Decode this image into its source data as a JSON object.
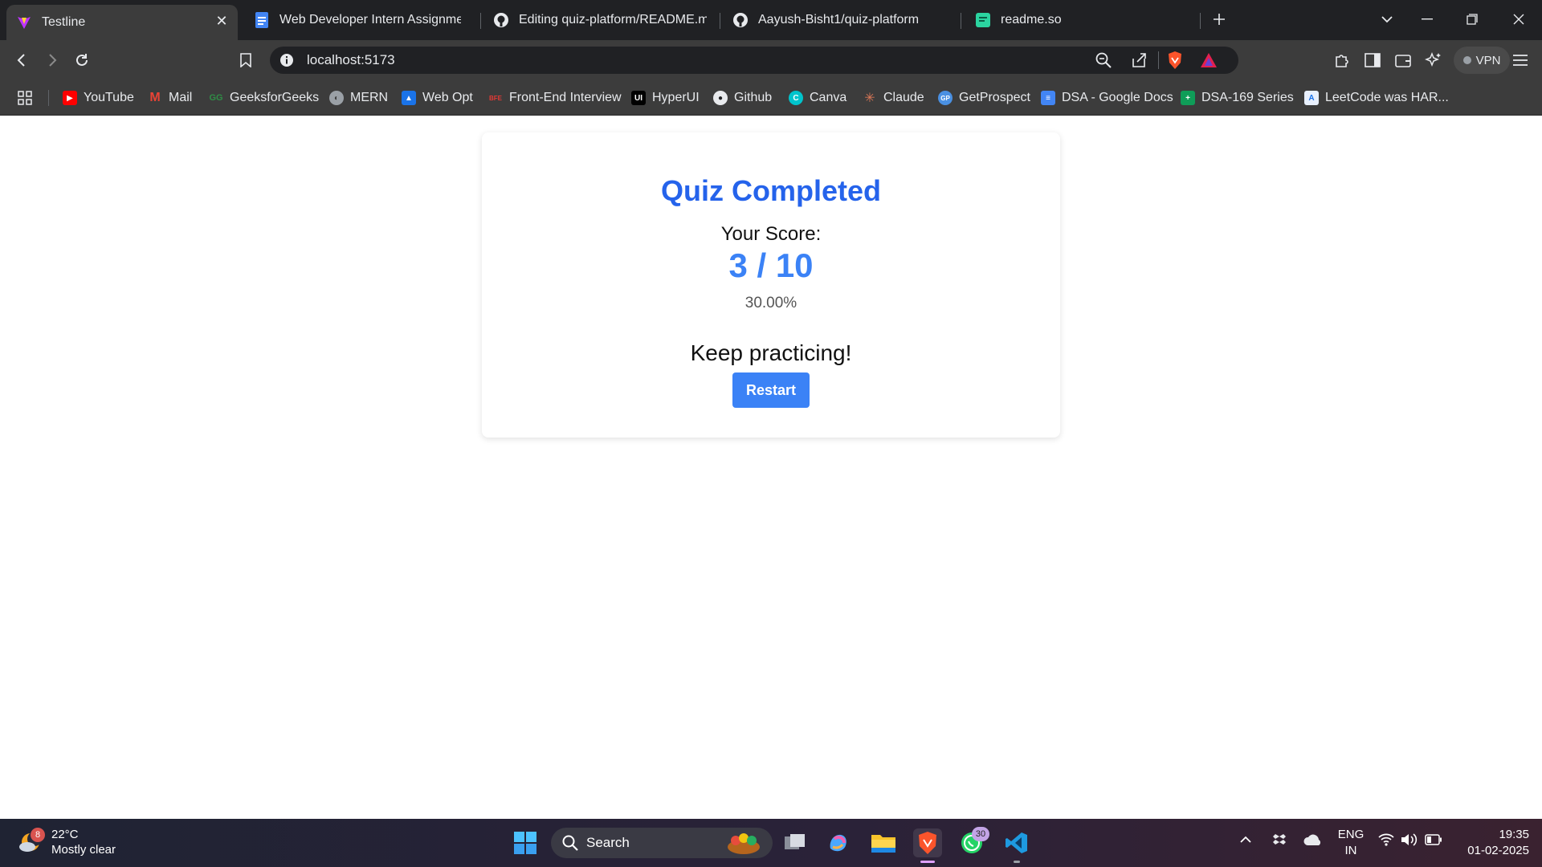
{
  "browser": {
    "tabs": [
      {
        "title": "Testline",
        "active": true,
        "icon": "vite-icon"
      },
      {
        "title": "Web Developer Intern Assignment -",
        "active": false,
        "icon": "google-docs-icon"
      },
      {
        "title": "Editing quiz-platform/README.md a",
        "active": false,
        "icon": "github-icon"
      },
      {
        "title": "Aayush-Bisht1/quiz-platform",
        "active": false,
        "icon": "github-icon"
      },
      {
        "title": "readme.so",
        "active": false,
        "icon": "readme-so-icon"
      }
    ],
    "url": "localhost:5173",
    "vpn_label": "VPN",
    "bookmarks": [
      {
        "label": "YouTube",
        "icon": "youtube-icon",
        "color": "#ff0000"
      },
      {
        "label": "Mail",
        "icon": "gmail-icon",
        "color": "#ea4335"
      },
      {
        "label": "GeeksforGeeks",
        "icon": "gfg-icon",
        "color": "#2f8d46"
      },
      {
        "label": "MERN",
        "icon": "globe-icon",
        "color": "#9aa0a6"
      },
      {
        "label": "Web Opt",
        "icon": "webopt-icon",
        "color": "#1a73e8"
      },
      {
        "label": "Front-End Interview",
        "icon": "bfe-icon",
        "color": "#e53935"
      },
      {
        "label": "HyperUI",
        "icon": "hyperui-icon",
        "color": "#000000"
      },
      {
        "label": "Github",
        "icon": "github-icon",
        "color": "#ffffff"
      },
      {
        "label": "Canva",
        "icon": "canva-icon",
        "color": "#00c4cc"
      },
      {
        "label": "Claude",
        "icon": "claude-icon",
        "color": "#d97757"
      },
      {
        "label": "GetProspect",
        "icon": "getprospect-icon",
        "color": "#4a90e2"
      },
      {
        "label": "DSA - Google Docs",
        "icon": "google-docs-icon",
        "color": "#4285f4"
      },
      {
        "label": "DSA-169 Series",
        "icon": "google-sheets-icon",
        "color": "#0f9d58"
      },
      {
        "label": "LeetCode was HAR...",
        "icon": "leetcode-icon",
        "color": "#1a73e8"
      }
    ]
  },
  "quiz": {
    "title": "Quiz Completed",
    "score_label": "Your Score:",
    "score": "3 / 10",
    "percentage": "30.00%",
    "message": "Keep practicing!",
    "restart_label": "Restart",
    "accent_color": "#2563eb",
    "button_color": "#3b82f6"
  },
  "taskbar": {
    "weather_temp": "22°C",
    "weather_desc": "Mostly clear",
    "weather_badge": "8",
    "search_placeholder": "Search",
    "whatsapp_badge": "30",
    "lang_line1": "ENG",
    "lang_line2": "IN",
    "time": "19:35",
    "date": "01-02-2025"
  }
}
